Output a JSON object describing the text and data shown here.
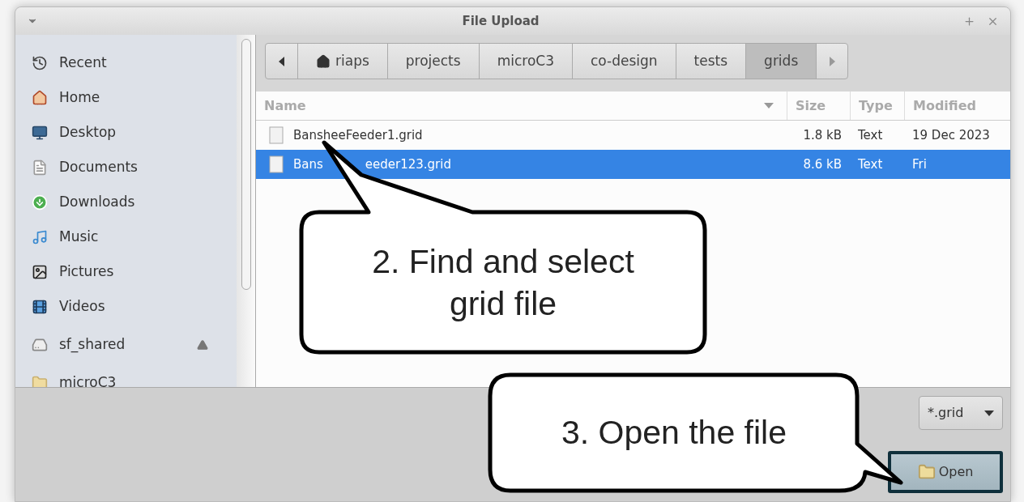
{
  "window": {
    "title": "File Upload"
  },
  "sidebar": {
    "items": [
      {
        "label": "Recent",
        "kind": "recent"
      },
      {
        "label": "Home",
        "kind": "home"
      },
      {
        "label": "Desktop",
        "kind": "desktop"
      },
      {
        "label": "Documents",
        "kind": "documents"
      },
      {
        "label": "Downloads",
        "kind": "downloads"
      },
      {
        "label": "Music",
        "kind": "music"
      },
      {
        "label": "Pictures",
        "kind": "pictures"
      },
      {
        "label": "Videos",
        "kind": "videos"
      },
      {
        "label": "sf_shared",
        "kind": "drive"
      },
      {
        "label": "microC3",
        "kind": "folder"
      }
    ]
  },
  "path_bar": {
    "segments": [
      {
        "label": "riaps",
        "kind": "home",
        "selected": false
      },
      {
        "label": "projects",
        "kind": "folder",
        "selected": false
      },
      {
        "label": "microC3",
        "kind": "folder",
        "selected": false
      },
      {
        "label": "co-design",
        "kind": "folder",
        "selected": false
      },
      {
        "label": "tests",
        "kind": "folder",
        "selected": false
      },
      {
        "label": "grids",
        "kind": "folder",
        "selected": true
      }
    ]
  },
  "file_list": {
    "columns": [
      "Name",
      "Size",
      "Type",
      "Modified"
    ],
    "rows": [
      {
        "name": "BansheeFeeder1.grid",
        "size": "1.8 kB",
        "type": "Text",
        "modified": "19 Dec 2023",
        "selected": false
      },
      {
        "name_parts": [
          "Bans",
          "eeder123.grid"
        ],
        "size": "8.6 kB",
        "type": "Text",
        "modified": "Fri",
        "selected": true
      }
    ]
  },
  "filter": {
    "value": "*.grid"
  },
  "open_button": {
    "label": "Open"
  },
  "callouts": [
    {
      "text": "2. Find and select grid file"
    },
    {
      "text": "3. Open the file"
    }
  ]
}
